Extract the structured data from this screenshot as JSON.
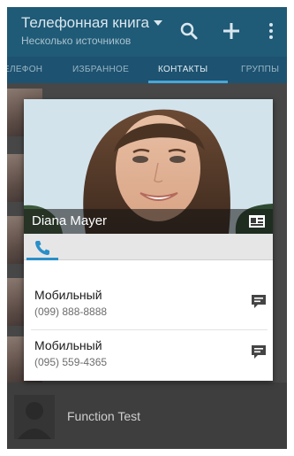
{
  "app_bar": {
    "title": "Телефонная книга",
    "subtitle": "Несколько источников",
    "icons": [
      "search-icon",
      "add-icon",
      "more-vert-icon"
    ],
    "color": "#1f5a76"
  },
  "tabs": [
    {
      "label": "ЕЛЕФОН",
      "active": false
    },
    {
      "label": "ИЗБРАННОЕ",
      "active": false
    },
    {
      "label": "КОНТАКТЫ",
      "active": true
    },
    {
      "label": "ГРУППЫ",
      "active": false
    }
  ],
  "contact_card": {
    "name": "Diana Mayer",
    "name_icon": "contact-card-icon",
    "active_tab_icon": "phone-icon",
    "phones": [
      {
        "label": "Мобильный",
        "number": "(099) 888-8888",
        "action_icon": "message-icon"
      },
      {
        "label": "Мобильный",
        "number": "(095) 559-4365",
        "action_icon": "message-icon"
      }
    ]
  },
  "list": {
    "bottom_item": {
      "name": "Function Test"
    }
  },
  "colors": {
    "accent": "#45a7d8",
    "tab_bar": "#1d5270"
  }
}
